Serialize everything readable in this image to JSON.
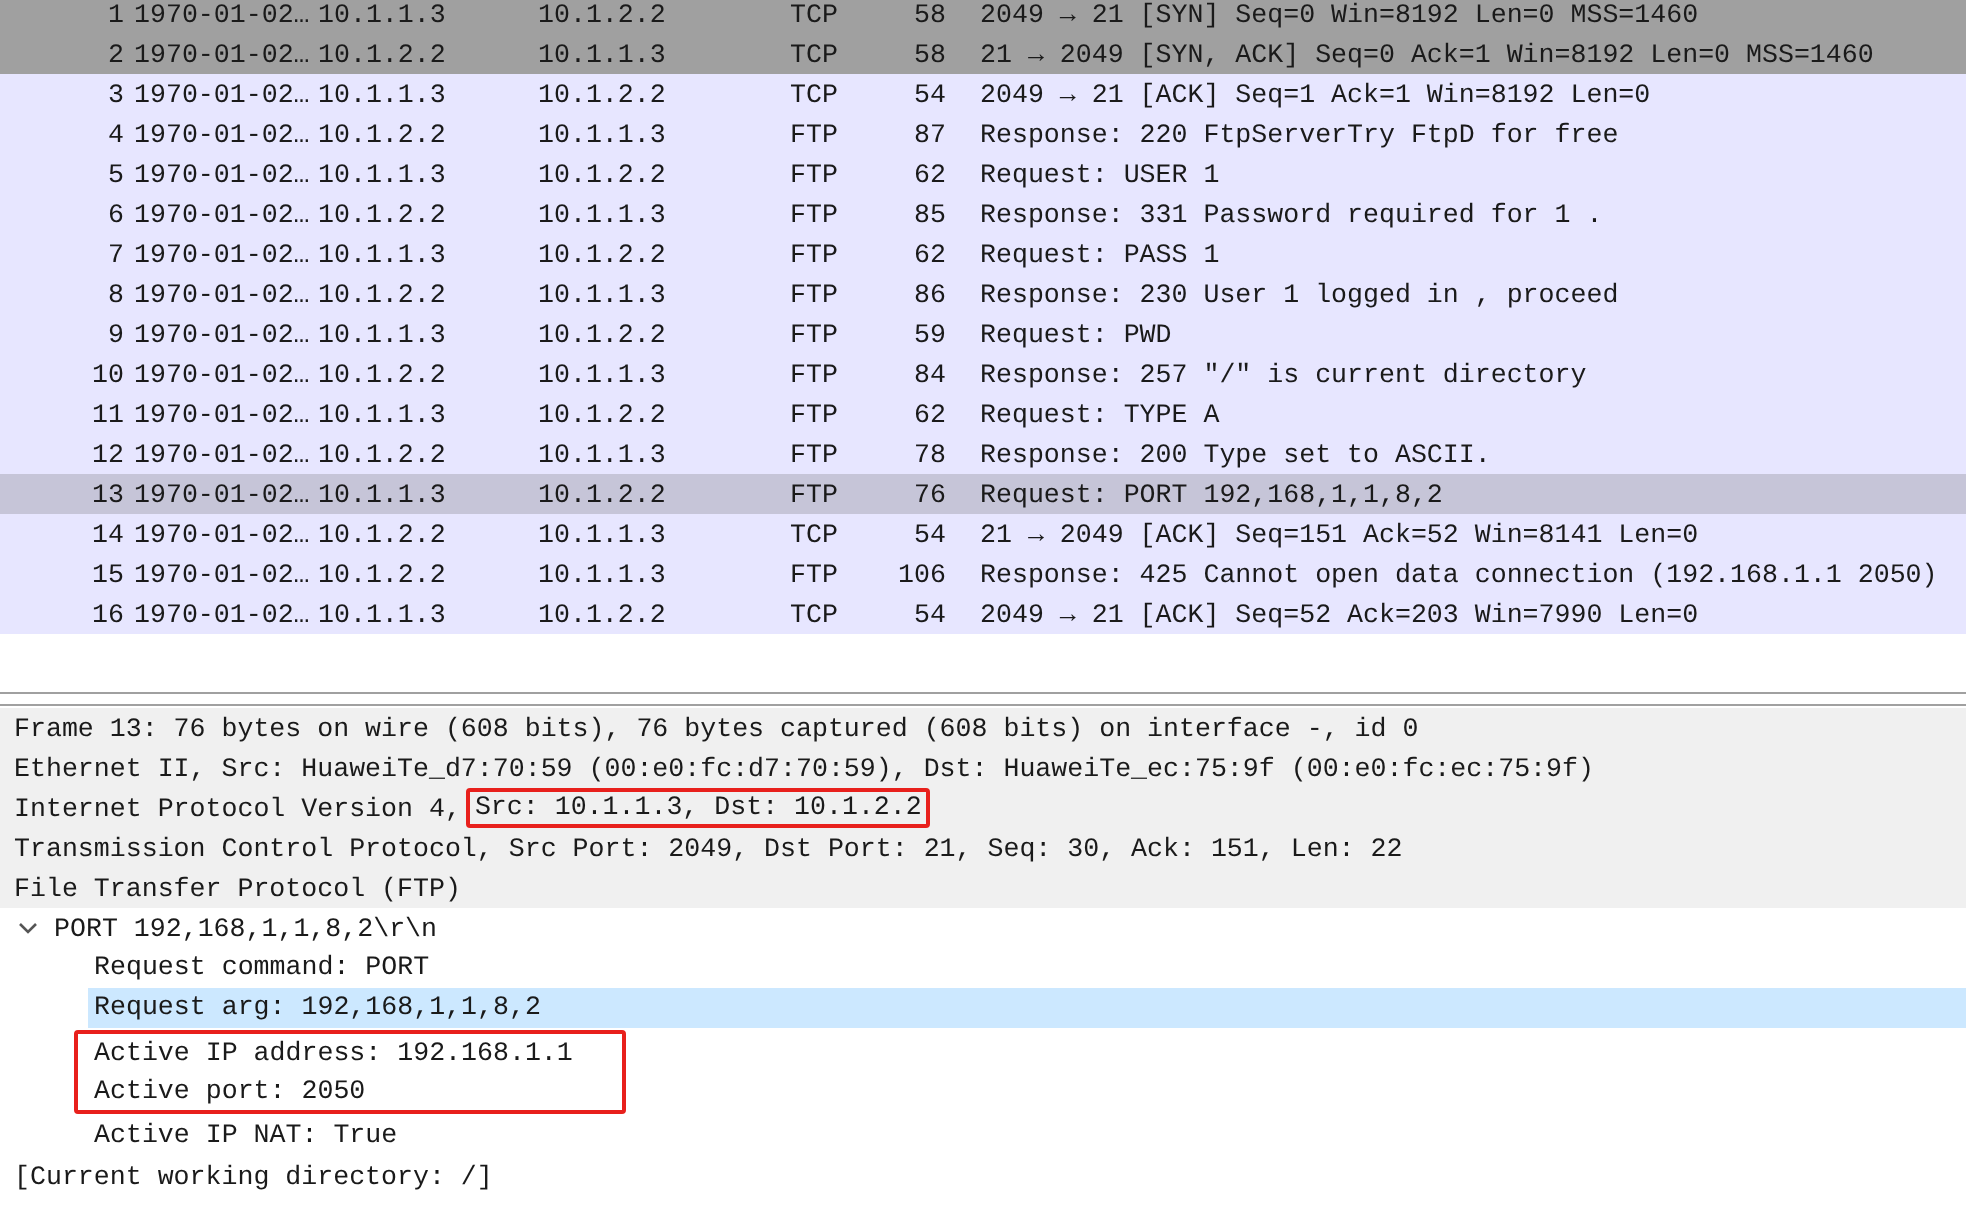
{
  "packet_list": {
    "rows": [
      {
        "no": "1",
        "time": "1970-01-02…",
        "source": "10.1.1.3",
        "destination": "10.1.2.2",
        "protocol": "TCP",
        "length": "58",
        "info": "2049 → 21 [SYN] Seq=0 Win=8192 Len=0 MSS=1460",
        "kind": "handshake",
        "selected": false
      },
      {
        "no": "2",
        "time": "1970-01-02…",
        "source": "10.1.2.2",
        "destination": "10.1.1.3",
        "protocol": "TCP",
        "length": "58",
        "info": "21 → 2049 [SYN, ACK] Seq=0 Ack=1 Win=8192 Len=0 MSS=1460",
        "kind": "handshake",
        "selected": false
      },
      {
        "no": "3",
        "time": "1970-01-02…",
        "source": "10.1.1.3",
        "destination": "10.1.2.2",
        "protocol": "TCP",
        "length": "54",
        "info": "2049 → 21 [ACK] Seq=1 Ack=1 Win=8192 Len=0",
        "kind": "normal",
        "selected": false
      },
      {
        "no": "4",
        "time": "1970-01-02…",
        "source": "10.1.2.2",
        "destination": "10.1.1.3",
        "protocol": "FTP",
        "length": "87",
        "info": "Response: 220 FtpServerTry FtpD for free",
        "kind": "normal",
        "selected": false
      },
      {
        "no": "5",
        "time": "1970-01-02…",
        "source": "10.1.1.3",
        "destination": "10.1.2.2",
        "protocol": "FTP",
        "length": "62",
        "info": "Request: USER 1",
        "kind": "normal",
        "selected": false
      },
      {
        "no": "6",
        "time": "1970-01-02…",
        "source": "10.1.2.2",
        "destination": "10.1.1.3",
        "protocol": "FTP",
        "length": "85",
        "info": "Response: 331 Password required for 1 .",
        "kind": "normal",
        "selected": false
      },
      {
        "no": "7",
        "time": "1970-01-02…",
        "source": "10.1.1.3",
        "destination": "10.1.2.2",
        "protocol": "FTP",
        "length": "62",
        "info": "Request: PASS 1",
        "kind": "normal",
        "selected": false
      },
      {
        "no": "8",
        "time": "1970-01-02…",
        "source": "10.1.2.2",
        "destination": "10.1.1.3",
        "protocol": "FTP",
        "length": "86",
        "info": "Response: 230 User 1 logged in , proceed",
        "kind": "normal",
        "selected": false
      },
      {
        "no": "9",
        "time": "1970-01-02…",
        "source": "10.1.1.3",
        "destination": "10.1.2.2",
        "protocol": "FTP",
        "length": "59",
        "info": "Request: PWD",
        "kind": "normal",
        "selected": false
      },
      {
        "no": "10",
        "time": "1970-01-02…",
        "source": "10.1.2.2",
        "destination": "10.1.1.3",
        "protocol": "FTP",
        "length": "84",
        "info": "Response: 257 \"/\" is current directory",
        "kind": "normal",
        "selected": false
      },
      {
        "no": "11",
        "time": "1970-01-02…",
        "source": "10.1.1.3",
        "destination": "10.1.2.2",
        "protocol": "FTP",
        "length": "62",
        "info": "Request: TYPE A",
        "kind": "normal",
        "selected": false
      },
      {
        "no": "12",
        "time": "1970-01-02…",
        "source": "10.1.2.2",
        "destination": "10.1.1.3",
        "protocol": "FTP",
        "length": "78",
        "info": "Response: 200 Type set to ASCII.",
        "kind": "normal",
        "selected": false
      },
      {
        "no": "13",
        "time": "1970-01-02…",
        "source": "10.1.1.3",
        "destination": "10.1.2.2",
        "protocol": "FTP",
        "length": "76",
        "info": "Request: PORT 192,168,1,1,8,2",
        "selected": true
      },
      {
        "no": "14",
        "time": "1970-01-02…",
        "source": "10.1.2.2",
        "destination": "10.1.1.3",
        "protocol": "TCP",
        "length": "54",
        "info": "21 → 2049 [ACK] Seq=151 Ack=52 Win=8141 Len=0",
        "kind": "normal",
        "selected": false
      },
      {
        "no": "15",
        "time": "1970-01-02…",
        "source": "10.1.2.2",
        "destination": "10.1.1.3",
        "protocol": "FTP",
        "length": "106",
        "info": "Response: 425 Cannot open data connection (192.168.1.1 2050)",
        "kind": "normal",
        "selected": false
      },
      {
        "no": "16",
        "time": "1970-01-02…",
        "source": "10.1.1.3",
        "destination": "10.1.2.2",
        "protocol": "TCP",
        "length": "54",
        "info": "2049 → 21 [ACK] Seq=52 Ack=203 Win=7990 Len=0",
        "kind": "normal",
        "selected": false
      }
    ]
  },
  "packet_details": {
    "items": [
      {
        "kind": "protocol",
        "text": "Frame 13: 76 bytes on wire (608 bits), 76 bytes captured (608 bits) on interface -, id 0"
      },
      {
        "kind": "protocol",
        "text": "Ethernet II, Src: HuaweiTe_d7:70:59 (00:e0:fc:d7:70:59), Dst: HuaweiTe_ec:75:9f (00:e0:fc:ec:75:9f)"
      },
      {
        "kind": "protocol",
        "text": "Internet Protocol Version 4,",
        "highlight": "Src: 10.1.1.3, Dst: 10.1.2.2"
      },
      {
        "kind": "protocol",
        "text": "Transmission Control Protocol, Src Port: 2049, Dst Port: 21, Seq: 30, Ack: 151, Len: 22"
      },
      {
        "kind": "protocol",
        "text": "File Transfer Protocol (FTP)"
      },
      {
        "kind": "field",
        "text": "PORT 192,168,1,1,8,2\\r\\n",
        "expanded": true,
        "children": [
          {
            "text": "Request command: PORT",
            "selected": false,
            "highlighted": false
          },
          {
            "text": "Request arg: 192,168,1,1,8,2",
            "selected": true,
            "highlighted": false
          },
          {
            "text": "Active IP address: 192.168.1.1",
            "selected": false,
            "highlighted": true
          },
          {
            "text": "Active port: 2050",
            "selected": false,
            "highlighted": true
          },
          {
            "text": "Active IP NAT: True",
            "selected": false,
            "highlighted": false
          }
        ]
      },
      {
        "kind": "info",
        "text": "[Current working directory: /]"
      }
    ]
  }
}
